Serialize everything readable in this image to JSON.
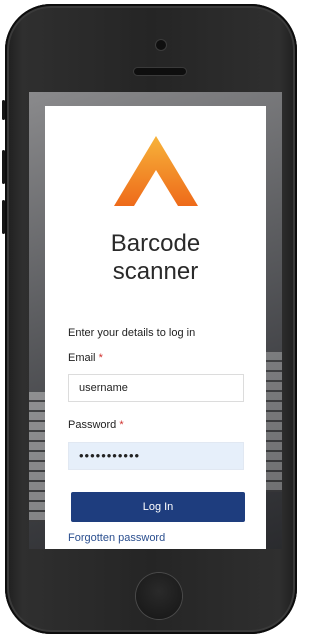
{
  "app": {
    "title_line1": "Barcode",
    "title_line2": "scanner"
  },
  "login": {
    "intro": "Enter your details to log in",
    "email_label": "Email",
    "email_value": "username",
    "password_label": "Password",
    "password_value": "•••••••••••",
    "required_mark": "*",
    "login_button": "Log In",
    "forgot_link": "Forgotten password"
  },
  "colors": {
    "accent": "#1e3d7e",
    "logo_orange": "#f28c1e",
    "required": "#d0312d"
  },
  "icons": {
    "logo": "chevron-a-logo-icon"
  }
}
